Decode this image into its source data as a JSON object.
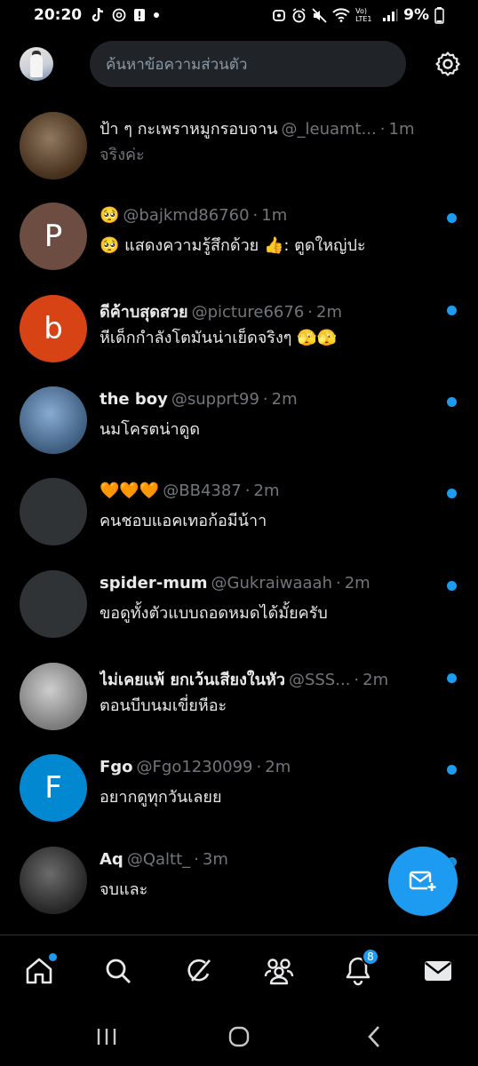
{
  "status_bar": {
    "time": "20:20",
    "left_icons": [
      "tiktok-icon",
      "threads-icon",
      "alert-icon",
      "dot-icon"
    ],
    "right_icons": [
      "cleanup-icon",
      "alarm-icon",
      "mute-icon",
      "wifi-icon",
      "volte-icon",
      "signal-icon"
    ],
    "volte_label": "Vo) LTE1",
    "battery": "9%"
  },
  "header": {
    "search_placeholder": "ค้นหาข้อความส่วนตัว"
  },
  "conversations": [
    {
      "name": "ป้า ๆ กะเพราหมูกรอบจาน",
      "name_bold": false,
      "handle": "@_leuamt...",
      "sep": "·",
      "time": "1m",
      "preview": "จริงค่ะ",
      "preview_muted": true,
      "unread": false,
      "avatar": {
        "type": "image",
        "color": "#6b4a2b"
      }
    },
    {
      "name": "🥺",
      "name_bold": false,
      "handle": "@bajkmd86760",
      "sep": "·",
      "time": "1m",
      "preview": "🥺 แสดงความรู้สึกด้วย 👍: ตูดใหญ่ปะ",
      "preview_muted": false,
      "unread": true,
      "avatar": {
        "type": "letter",
        "letter": "P",
        "color": "#6d4c41"
      }
    },
    {
      "name": "ดีค้าบสุดสวย",
      "name_bold": true,
      "handle": "@picture6676",
      "sep": "·",
      "time": "2m",
      "preview": "หีเด็กกำลังโตมันน่าเย็ดจริงๆ 🫣🫣",
      "preview_muted": false,
      "unread": true,
      "avatar": {
        "type": "letter",
        "letter": "b",
        "color": "#d84315"
      }
    },
    {
      "name": "the boy",
      "name_bold": true,
      "handle": "@supprt99",
      "sep": "·",
      "time": "2m",
      "preview": "นมโครตน่าดูด",
      "preview_muted": false,
      "unread": true,
      "avatar": {
        "type": "image",
        "color": "#5f8fc2"
      }
    },
    {
      "name": "🧡🧡🧡",
      "name_bold": false,
      "handle": "@BB4387",
      "sep": "·",
      "time": "2m",
      "preview": "คนชอบแอคเทอก้อมีน้าา",
      "preview_muted": false,
      "unread": true,
      "avatar": {
        "type": "blank",
        "color": "#2f3336"
      }
    },
    {
      "name": "spider-mum",
      "name_bold": true,
      "handle": "@Gukraiwaaah",
      "sep": "·",
      "time": "2m",
      "preview": "ขอดูทั้งตัวแบบถอดหมดได้มั้ยครับ",
      "preview_muted": false,
      "unread": true,
      "avatar": {
        "type": "blank",
        "color": "#2f3336"
      }
    },
    {
      "name": "ไม่เคยแพ้ ยกเว้นเสียงในหัว",
      "name_bold": true,
      "handle": "@SSS...",
      "sep": "·",
      "time": "2m",
      "preview": "ตอนบีบนมเขี่ยหีอะ",
      "preview_muted": false,
      "unread": true,
      "avatar": {
        "type": "image",
        "color": "#bdbdbd"
      }
    },
    {
      "name": "Fgo",
      "name_bold": true,
      "handle": "@Fgo1230099",
      "sep": "·",
      "time": "2m",
      "preview": "อยากดูทุกวันเลยย",
      "preview_muted": false,
      "unread": true,
      "avatar": {
        "type": "letter",
        "letter": "F",
        "color": "#0288d1"
      }
    },
    {
      "name": "Aq",
      "name_bold": true,
      "handle": "@Qaltt_",
      "sep": "·",
      "time": "3m",
      "preview": "จบและ",
      "preview_muted": false,
      "unread": true,
      "avatar": {
        "type": "image",
        "color": "#3a3a3a"
      }
    }
  ],
  "fab": {
    "icon": "new-message-icon"
  },
  "bottom_nav": {
    "items": [
      "home-icon",
      "search-icon",
      "grok-icon",
      "communities-icon",
      "notifications-icon",
      "messages-icon"
    ],
    "notifications_badge": "8"
  },
  "system_nav": [
    "recents-icon",
    "home-circle-icon",
    "back-icon"
  ],
  "colors": {
    "accent": "#1d9bf0",
    "background": "#000000",
    "muted_text": "#71767b",
    "search_bg": "#202327"
  }
}
